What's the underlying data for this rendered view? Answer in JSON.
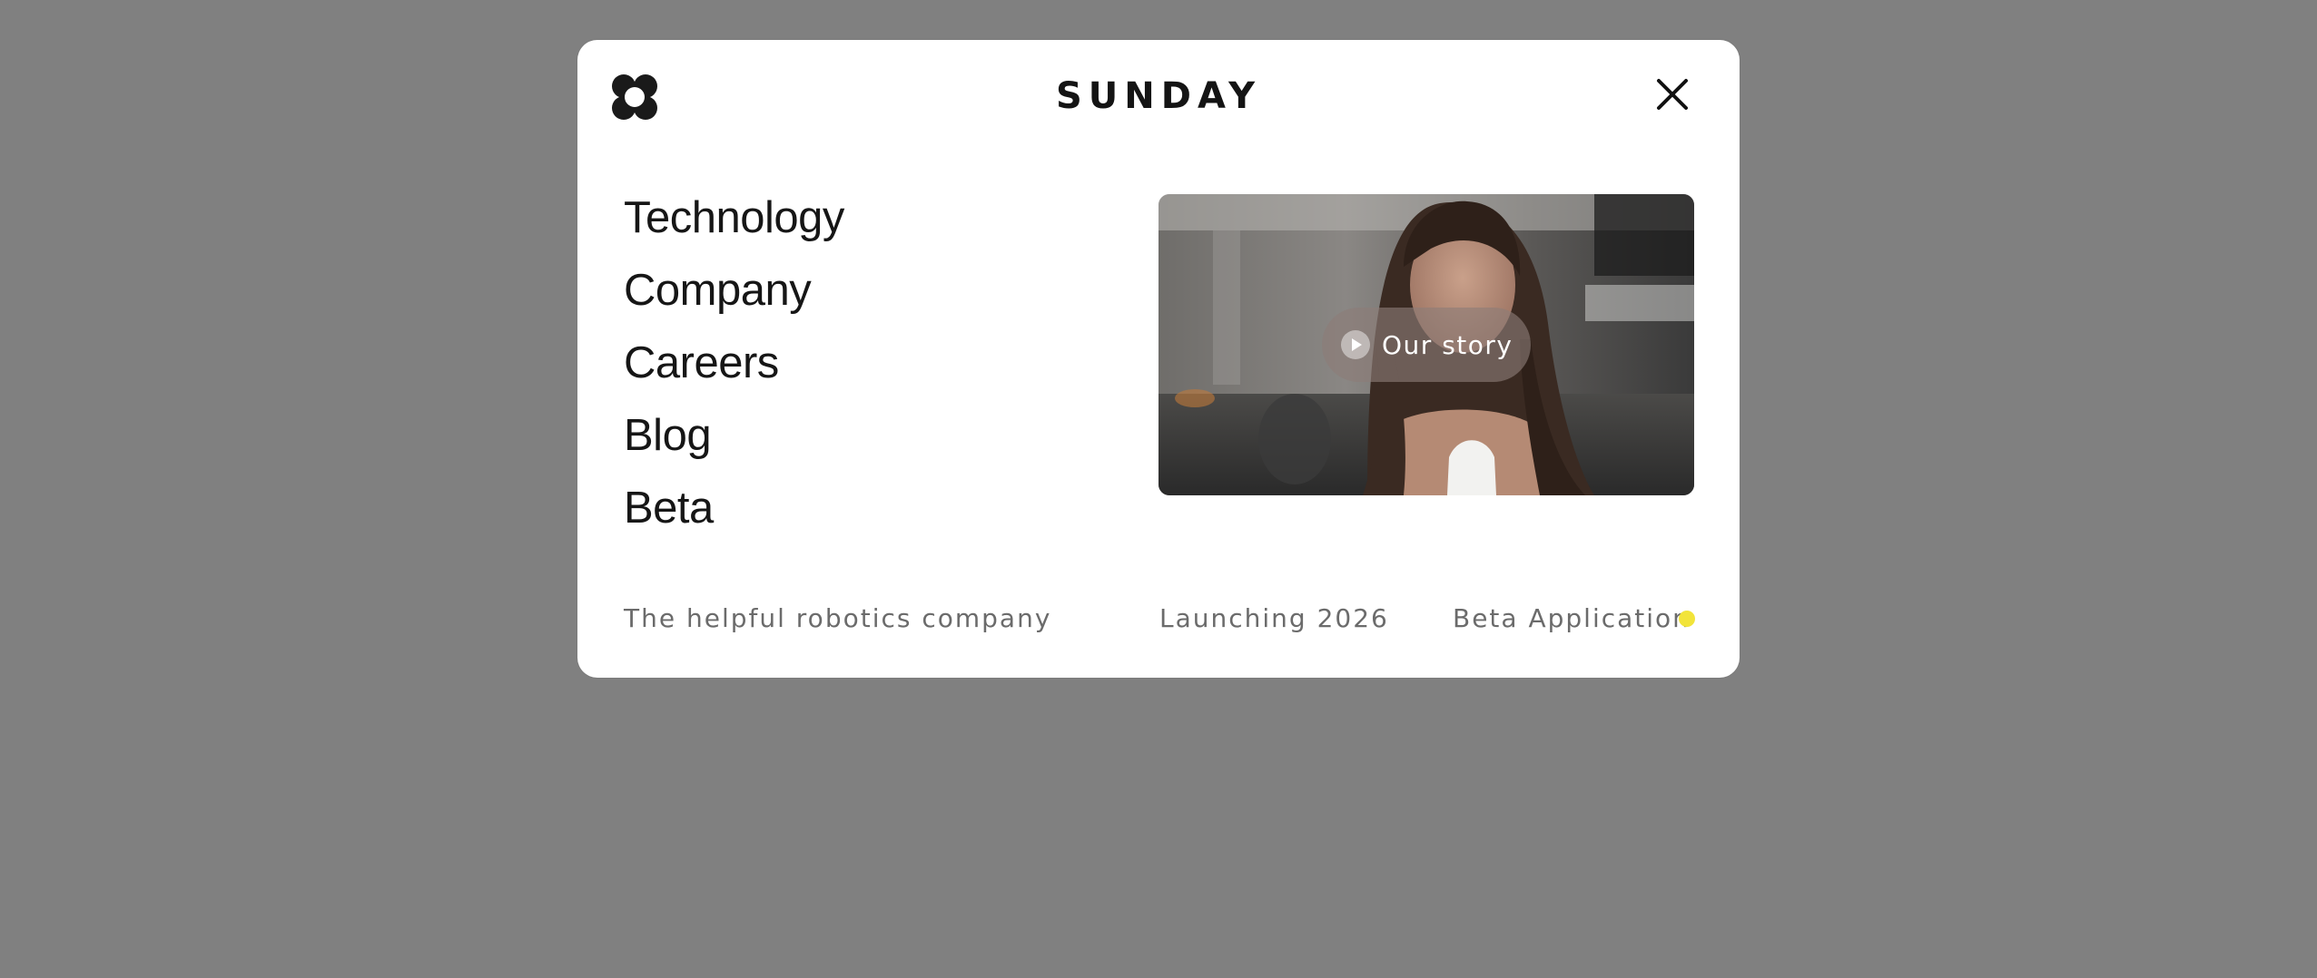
{
  "brand": {
    "name": "SUNDAY",
    "logo_icon": "flower-logo-icon"
  },
  "close": {
    "icon": "close-icon"
  },
  "nav": {
    "items": [
      {
        "label": "Technology"
      },
      {
        "label": "Company"
      },
      {
        "label": "Careers"
      },
      {
        "label": "Blog"
      },
      {
        "label": "Beta"
      }
    ]
  },
  "video": {
    "button_label": "Our story",
    "play_icon": "play-icon"
  },
  "footer": {
    "tagline": "The helpful robotics company",
    "launch": "Launching 2026",
    "beta_application": "Beta Application",
    "status_color": "#f2e43a"
  },
  "colors": {
    "backdrop": "#808080",
    "panel": "#ffffff",
    "text": "#161616",
    "muted": "#6b6b6b"
  }
}
